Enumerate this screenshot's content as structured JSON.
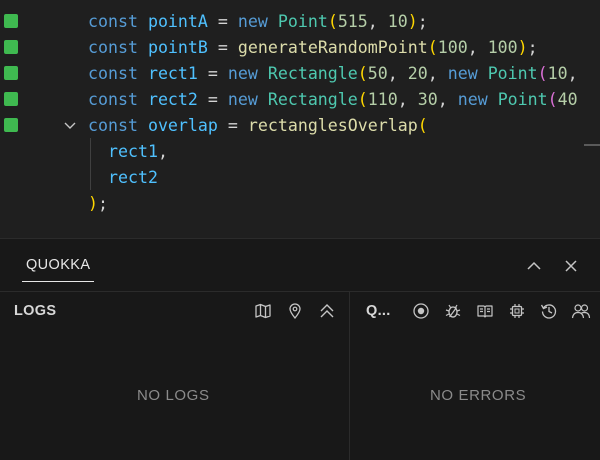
{
  "editor": {
    "lines": [
      [
        [
          "kw",
          "const "
        ],
        [
          "var",
          "pointA"
        ],
        [
          "op",
          " = "
        ],
        [
          "kw",
          "new "
        ],
        [
          "cls",
          "Point"
        ],
        [
          "b1",
          "("
        ],
        [
          "num",
          "515"
        ],
        [
          "pn",
          ", "
        ],
        [
          "num",
          "10"
        ],
        [
          "b1",
          ")"
        ],
        [
          "pn",
          ";"
        ]
      ],
      [
        [
          "kw",
          "const "
        ],
        [
          "var",
          "pointB"
        ],
        [
          "op",
          " = "
        ],
        [
          "fn",
          "generateRandomPoint"
        ],
        [
          "b1",
          "("
        ],
        [
          "num",
          "100"
        ],
        [
          "pn",
          ", "
        ],
        [
          "num",
          "100"
        ],
        [
          "b1",
          ")"
        ],
        [
          "pn",
          ";"
        ]
      ],
      [
        [
          "kw",
          "const "
        ],
        [
          "var",
          "rect1"
        ],
        [
          "op",
          " = "
        ],
        [
          "kw",
          "new "
        ],
        [
          "cls",
          "Rectangle"
        ],
        [
          "b1",
          "("
        ],
        [
          "num",
          "50"
        ],
        [
          "pn",
          ", "
        ],
        [
          "num",
          "20"
        ],
        [
          "pn",
          ", "
        ],
        [
          "kw",
          "new "
        ],
        [
          "cls",
          "Point"
        ],
        [
          "b2",
          "("
        ],
        [
          "num",
          "10"
        ],
        [
          "pn",
          ","
        ]
      ],
      [
        [
          "kw",
          "const "
        ],
        [
          "var",
          "rect2"
        ],
        [
          "op",
          " = "
        ],
        [
          "kw",
          "new "
        ],
        [
          "cls",
          "Rectangle"
        ],
        [
          "b1",
          "("
        ],
        [
          "num",
          "110"
        ],
        [
          "pn",
          ", "
        ],
        [
          "num",
          "30"
        ],
        [
          "pn",
          ", "
        ],
        [
          "kw",
          "new "
        ],
        [
          "cls",
          "Point"
        ],
        [
          "b2",
          "("
        ],
        [
          "num",
          "40"
        ]
      ],
      [
        [
          "kw",
          "const "
        ],
        [
          "var",
          "overlap"
        ],
        [
          "op",
          " = "
        ],
        [
          "fn",
          "rectanglesOverlap"
        ],
        [
          "b1",
          "("
        ]
      ],
      [
        [
          "var",
          "  rect1"
        ],
        [
          "pn",
          ","
        ]
      ],
      [
        [
          "var",
          "  rect2"
        ]
      ],
      [
        [
          "b1",
          ")"
        ],
        [
          "pn",
          ";"
        ]
      ]
    ]
  },
  "panel": {
    "tab_label": "QUOKKA",
    "logs": {
      "title": "LOGS",
      "empty_message": "NO LOGS",
      "icons": [
        "map-icon",
        "location-pin-icon",
        "collapse-all-icon"
      ]
    },
    "errors": {
      "title": "Q...",
      "empty_message": "NO ERRORS",
      "icons": [
        "record-icon",
        "debug-icon",
        "book-icon",
        "chip-icon",
        "history-icon",
        "users-icon"
      ]
    }
  },
  "colors": {
    "gutter_marker": "#3fb950",
    "keyword": "#569cd6",
    "variable": "#4fc1ff",
    "class": "#4ec9b0",
    "function": "#dcdcaa",
    "number": "#b5cea8",
    "bracket_level1": "#ffd700",
    "bracket_level2": "#da70d6"
  }
}
